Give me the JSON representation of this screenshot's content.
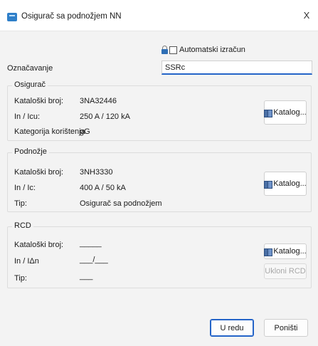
{
  "window": {
    "title": "Osigurač sa podnožjem NN",
    "close_glyph": "X"
  },
  "auto": {
    "label": "Automatski izračun",
    "checked": false
  },
  "oznacavanje": {
    "label": "Označavanje",
    "value": "SSRc"
  },
  "osigurac": {
    "title": "Osigurač",
    "rows": [
      {
        "label": "Kataloški broj:",
        "value": "3NA32446"
      },
      {
        "label": "In / Icu:",
        "value": "250 A / 120 kA"
      },
      {
        "label": "Kategorija korištenja",
        "value": "gG"
      }
    ],
    "catalog_button": "Katalog..."
  },
  "podnozje": {
    "title": "Podnožje",
    "rows": [
      {
        "label": "Kataloški broj:",
        "value": "3NH3330"
      },
      {
        "label": "In / Ic:",
        "value": "400 A / 50 kA"
      },
      {
        "label": "Tip:",
        "value": "Osigurač sa podnožjem"
      }
    ],
    "catalog_button": "Katalog..."
  },
  "rcd": {
    "title": "RCD",
    "rows": [
      {
        "label": "Kataloški broj:",
        "value": "_____"
      },
      {
        "label": "In / IΔn",
        "value": "___/___"
      },
      {
        "label": "Tip:",
        "value": "___"
      }
    ],
    "catalog_button": "Katalog...",
    "remove_button": "Ukloni RCD"
  },
  "footer": {
    "ok": "U redu",
    "cancel": "Poništi"
  },
  "icons": {
    "app": "app-icon",
    "lock": "lock-icon",
    "book": "book-icon"
  }
}
